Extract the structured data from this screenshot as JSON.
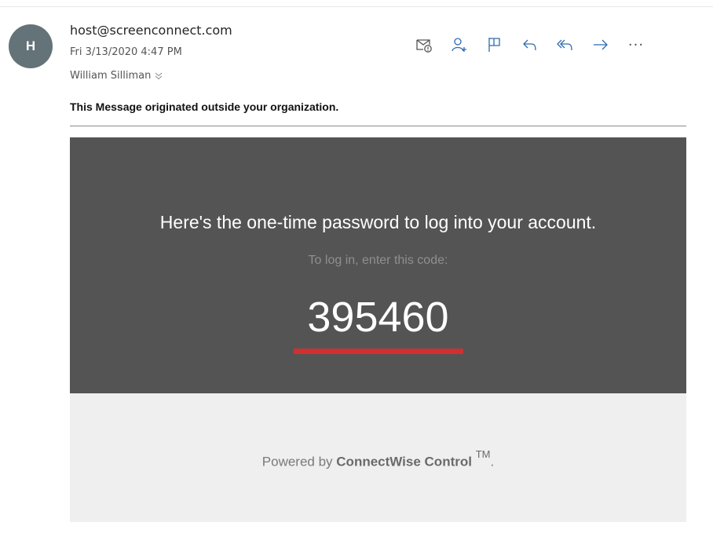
{
  "header": {
    "avatar_initial": "H",
    "sender": "host@screenconnect.com",
    "date": "Fri 3/13/2020 4:47 PM",
    "recipient": "William Silliman"
  },
  "toolbar": {
    "icons": [
      "immersive-reader-icon",
      "add-contact-icon",
      "flag-icon",
      "reply-icon",
      "reply-all-icon",
      "forward-icon",
      "more-actions-icon"
    ],
    "more_label": "···"
  },
  "notice": {
    "external_warning": "This Message originated outside your organization."
  },
  "email_body": {
    "headline": "Here's the one-time password to log into your account.",
    "instruction": "To log in, enter this code:",
    "code": "395460",
    "accent_color": "#d22f2f",
    "banner_color": "#545454"
  },
  "footer": {
    "powered_prefix": "Powered by ",
    "brand": "ConnectWise Control",
    "trademark": "TM",
    "suffix": "."
  }
}
